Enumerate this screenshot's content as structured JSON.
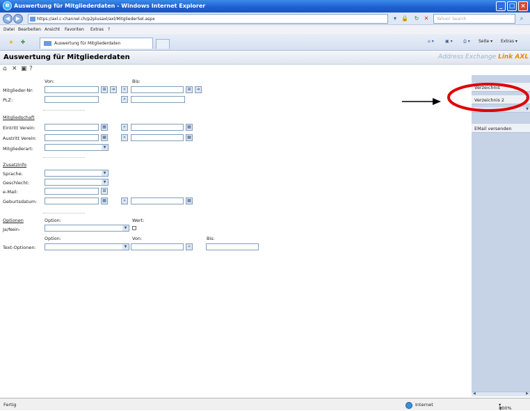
{
  "window": {
    "title": "Auswertung für Mitgliederdaten - Windows Internet Explorer",
    "url": "https://axl.c-channel.ch/p2plusaxl/axl/MitgliederSel.aspx",
    "search_placeholder": "Yahoo! Search"
  },
  "menu": [
    "Datei",
    "Bearbeiten",
    "Ansicht",
    "Favoriten",
    "Extras",
    "?"
  ],
  "tab": {
    "label": "Auswertung für Mitgliederdaten"
  },
  "ie_toolbar": {
    "page": "Seite",
    "tools": "Extras"
  },
  "app": {
    "title": "Auswertung für Mitgliederdaten",
    "brand": "Address Exchange",
    "brand_suffix": "Link AXL",
    "toolbar_help": "?"
  },
  "form": {
    "col_from": "Von:",
    "col_to": "Bis:",
    "mitglieder_nr": "Mitglieder-Nr:",
    "plz": "PLZ:",
    "section_membership": "Mitgliedschaft",
    "eintritt": "Eintritt Verein:",
    "austritt": "Austritt Verein:",
    "mitgliederart": "Mitgliederart:",
    "section_additional": "Zusatzinfo",
    "sprache": "Sprache:",
    "geschlecht": "Geschlecht:",
    "email": "e-Mail:",
    "geburtsdatum": "Geburtsdatum:",
    "section_options": "Optionen",
    "option_label": "Option:",
    "value_label": "Wert:",
    "janein": "Ja/Nein-",
    "option_label2": "Option:",
    "von_label": "Von:",
    "bis_label": "Bis:",
    "textoptionen": "Text-Optionen:"
  },
  "right_panel": {
    "items": [
      "Verzeichnis",
      "Verzeichnis 2",
      "EMail versenden"
    ]
  },
  "status": {
    "left": "Fertig",
    "zone": "Internet",
    "zoom": "100%"
  }
}
